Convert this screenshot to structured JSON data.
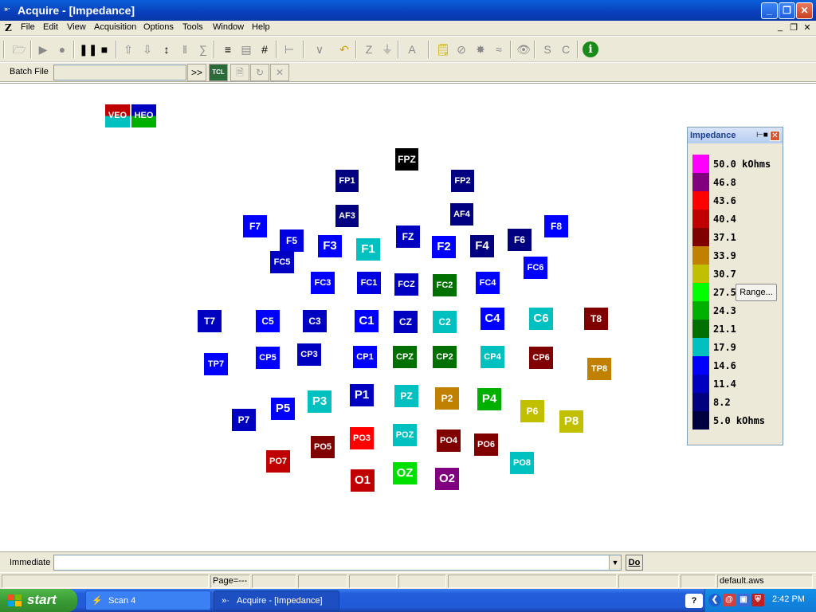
{
  "window": {
    "title": "Acquire - [Impedance]",
    "minimize": "_",
    "restore": "❐",
    "close": "✕"
  },
  "menubar": {
    "items": [
      "File",
      "Edit",
      "View",
      "Acquisition",
      "Options",
      "Tools",
      "Window",
      "Help"
    ],
    "mdi_min": "_",
    "mdi_restore": "❐",
    "mdi_close": "✕"
  },
  "batch": {
    "label": "Batch File",
    "value": "",
    "go_label": ">>"
  },
  "eog": [
    {
      "name": "VEO",
      "colors": [
        "#c00000",
        "#00c0c0"
      ]
    },
    {
      "name": "HEO",
      "colors": [
        "#0000c0",
        "#00b000"
      ]
    }
  ],
  "electrodes": [
    {
      "name": "FPZ",
      "color": "#000000"
    },
    {
      "name": "FP1",
      "color": "#000080"
    },
    {
      "name": "FP2",
      "color": "#000080"
    },
    {
      "name": "AF3",
      "color": "#000080"
    },
    {
      "name": "AF4",
      "color": "#000080"
    },
    {
      "name": "F7",
      "color": "#0000ff"
    },
    {
      "name": "F5",
      "color": "#0000e0"
    },
    {
      "name": "F3",
      "color": "#0000ff"
    },
    {
      "name": "F1",
      "color": "#00c0c0"
    },
    {
      "name": "FZ",
      "color": "#0000c0"
    },
    {
      "name": "F2",
      "color": "#0000ff"
    },
    {
      "name": "F4",
      "color": "#000080"
    },
    {
      "name": "F6",
      "color": "#000080"
    },
    {
      "name": "F8",
      "color": "#0000ff"
    },
    {
      "name": "FC5",
      "color": "#0000c0"
    },
    {
      "name": "FC3",
      "color": "#0000ff"
    },
    {
      "name": "FC1",
      "color": "#0000e0"
    },
    {
      "name": "FCZ",
      "color": "#0000c0"
    },
    {
      "name": "FC2",
      "color": "#007000"
    },
    {
      "name": "FC4",
      "color": "#0000ff"
    },
    {
      "name": "FC6",
      "color": "#0000ff"
    },
    {
      "name": "T7",
      "color": "#0000c0"
    },
    {
      "name": "C5",
      "color": "#0000ff"
    },
    {
      "name": "C3",
      "color": "#0000c0"
    },
    {
      "name": "C1",
      "color": "#0000ff"
    },
    {
      "name": "CZ",
      "color": "#0000c0"
    },
    {
      "name": "C2",
      "color": "#00c0c0"
    },
    {
      "name": "C4",
      "color": "#0000ff"
    },
    {
      "name": "C6",
      "color": "#00c0c0"
    },
    {
      "name": "T8",
      "color": "#800000"
    },
    {
      "name": "TP7",
      "color": "#0000ff"
    },
    {
      "name": "CP5",
      "color": "#0000ff"
    },
    {
      "name": "CP3",
      "color": "#0000c0"
    },
    {
      "name": "CP1",
      "color": "#0000ff"
    },
    {
      "name": "CPZ",
      "color": "#007000"
    },
    {
      "name": "CP2",
      "color": "#007000"
    },
    {
      "name": "CP4",
      "color": "#00c0c0"
    },
    {
      "name": "CP6",
      "color": "#800000"
    },
    {
      "name": "TP8",
      "color": "#c08000"
    },
    {
      "name": "P7",
      "color": "#0000c0"
    },
    {
      "name": "P5",
      "color": "#0000ff"
    },
    {
      "name": "P3",
      "color": "#00c0c0"
    },
    {
      "name": "P1",
      "color": "#0000c0"
    },
    {
      "name": "PZ",
      "color": "#00c0c0"
    },
    {
      "name": "P2",
      "color": "#c08000"
    },
    {
      "name": "P4",
      "color": "#00b000"
    },
    {
      "name": "P6",
      "color": "#c0c000"
    },
    {
      "name": "P8",
      "color": "#c0c000"
    },
    {
      "name": "PO7",
      "color": "#c00000"
    },
    {
      "name": "PO5",
      "color": "#800000"
    },
    {
      "name": "PO3",
      "color": "#ff0000"
    },
    {
      "name": "POZ",
      "color": "#00c0c0"
    },
    {
      "name": "PO4",
      "color": "#800000"
    },
    {
      "name": "PO6",
      "color": "#800000"
    },
    {
      "name": "PO8",
      "color": "#00c0c0"
    },
    {
      "name": "O1",
      "color": "#c00000"
    },
    {
      "name": "OZ",
      "color": "#00e000"
    },
    {
      "name": "O2",
      "color": "#800080"
    }
  ],
  "impedance_panel": {
    "title": "Impedance",
    "range_button": "Range...",
    "legend": [
      {
        "label": "50.0 kOhms",
        "color": "#ff00ff"
      },
      {
        "label": "46.8",
        "color": "#800080"
      },
      {
        "label": "43.6",
        "color": "#ff0000"
      },
      {
        "label": "40.4",
        "color": "#c00000"
      },
      {
        "label": "37.1",
        "color": "#800000"
      },
      {
        "label": "33.9",
        "color": "#c08000"
      },
      {
        "label": "30.7",
        "color": "#c0c000"
      },
      {
        "label": "27.5",
        "color": "#00ff00"
      },
      {
        "label": "24.3",
        "color": "#00b000"
      },
      {
        "label": "21.1",
        "color": "#007000"
      },
      {
        "label": "17.9",
        "color": "#00c0c0"
      },
      {
        "label": "14.6",
        "color": "#0000ff"
      },
      {
        "label": "11.4",
        "color": "#0000c0"
      },
      {
        "label": "8.2",
        "color": "#000080"
      },
      {
        "label": "5.0 kOhms",
        "color": "#000040"
      }
    ]
  },
  "immediate": {
    "label": "Immediate",
    "value": "",
    "do_label": "Do"
  },
  "statusbar": {
    "page": "Page=---",
    "workspace": "default.aws"
  },
  "taskbar": {
    "start": "start",
    "tasks": [
      "Scan 4",
      "Acquire - [Impedance]"
    ],
    "clock": "2:42 PM"
  }
}
